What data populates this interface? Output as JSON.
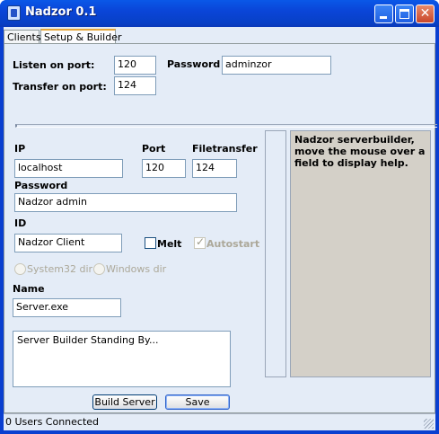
{
  "window": {
    "title": "Nadzor 0.1"
  },
  "tabs": [
    {
      "label": "Clients"
    },
    {
      "label": "Setup & Builder"
    }
  ],
  "listen": {
    "label": "Listen on port:",
    "value": "120"
  },
  "password_top": {
    "label": "Password",
    "value": "adminzor"
  },
  "transfer": {
    "label": "Transfer on port:",
    "value": "124"
  },
  "builder": {
    "ip": {
      "label": "IP",
      "value": "localhost"
    },
    "port": {
      "label": "Port",
      "value": "120"
    },
    "filetransfer": {
      "label": "Filetransfer",
      "value": "124"
    },
    "password": {
      "label": "Password",
      "value": "Nadzor admin"
    },
    "id": {
      "label": "ID",
      "value": "Nadzor Client"
    },
    "melt": {
      "label": "Melt",
      "checked": false
    },
    "autostart": {
      "label": "Autostart",
      "checked": true,
      "enabled": false
    },
    "dirs": [
      {
        "label": "System32 dir",
        "enabled": false
      },
      {
        "label": "Windows dir",
        "enabled": false
      }
    ],
    "name": {
      "label": "Name",
      "value": "Server.exe"
    },
    "log": "Server Builder Standing By...",
    "build_label": "Build Server",
    "save_label": "Save"
  },
  "help": {
    "text": "Nadzor serverbuilder, move the mouse over a field to display help."
  },
  "status": {
    "text": "0 Users Connected"
  },
  "colors": {
    "titlebar": "#0a45d8",
    "panel": "#e4ecf7",
    "help_bg": "#d4d0c8"
  },
  "icons": [
    "app-icon",
    "minimize-icon",
    "maximize-icon",
    "close-icon",
    "checkmark-icon",
    "resize-grip-icon"
  ]
}
